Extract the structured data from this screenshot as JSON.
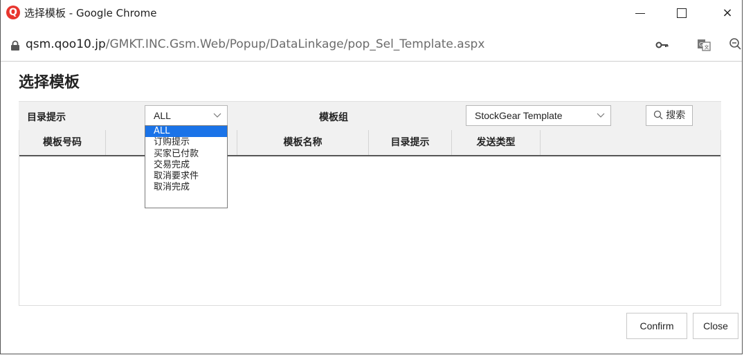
{
  "window": {
    "app_icon_letter": "Q",
    "title": "选择模板 - Google Chrome",
    "minimize_label": "Minimize",
    "maximize_label": "Maximize",
    "close_glyph": "×"
  },
  "address_bar": {
    "url_host": "qsm.qoo10.jp",
    "url_path": "/GMKT.INC.Gsm.Web/Popup/DataLinkage/pop_Sel_Template.aspx",
    "icons": [
      "lock-icon",
      "key-icon",
      "translate-icon",
      "zoom-out-icon"
    ]
  },
  "page": {
    "title": "选择模板"
  },
  "filters": {
    "category_label": "目录提示",
    "category_value": "ALL",
    "group_label": "模板组",
    "group_value": "StockGear Template",
    "search_label": "搜索"
  },
  "dropdown": {
    "options": [
      "ALL",
      "订购提示",
      "买家已付款",
      "交易完成",
      "取消要求件",
      "取消完成"
    ],
    "selected_index": 0
  },
  "table": {
    "headers": [
      "模板号码",
      "",
      "模板名称",
      "目录提示",
      "发送类型"
    ],
    "rows": []
  },
  "footer": {
    "confirm_label": "Confirm",
    "close_label": "Close"
  },
  "colors": {
    "accent": "#1a73e8",
    "brand": "#e8352e",
    "header_bg": "#f1f1f1"
  }
}
